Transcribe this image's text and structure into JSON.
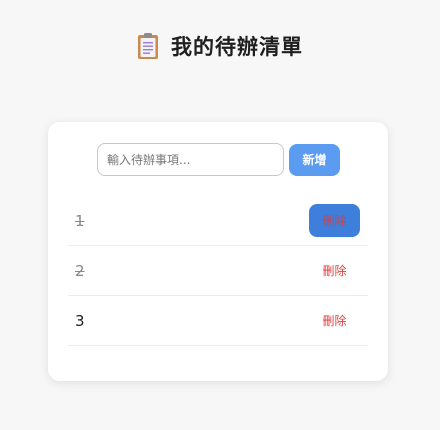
{
  "header": {
    "icon": "clipboard-icon",
    "title": "我的待辦清單"
  },
  "form": {
    "placeholder": "輸入待辦事項...",
    "input_value": "",
    "add_label": "新增"
  },
  "todos": [
    {
      "text": "1",
      "completed": true,
      "delete_label": "刪除",
      "delete_hovered": true
    },
    {
      "text": "2",
      "completed": true,
      "delete_label": "刪除",
      "delete_hovered": false
    },
    {
      "text": "3",
      "completed": false,
      "delete_label": "刪除",
      "delete_hovered": false
    }
  ],
  "colors": {
    "accent": "#5b9cf0",
    "delete_text": "#e23a3a",
    "delete_hover_bg": "#3f7fdc"
  }
}
